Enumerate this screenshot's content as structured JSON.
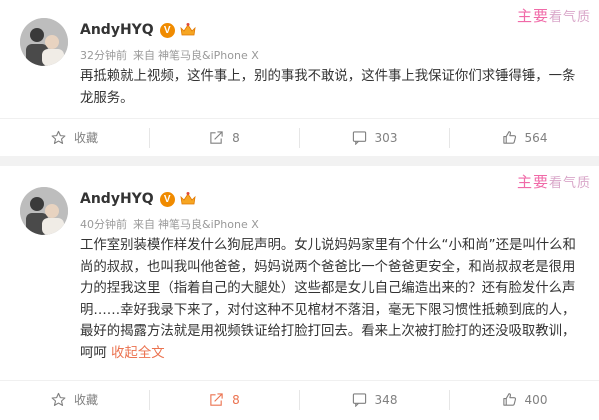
{
  "watermark": {
    "part1": "主要",
    "part2": "看气质"
  },
  "posts": [
    {
      "username": "AndyHYQ",
      "verified_badge": "V",
      "time": "32分钟前",
      "source_prefix": "来自",
      "source": "神笔马良&iPhone X",
      "text": "再抵赖就上视频，这件事上，别的事我不敢说，这件事上我保证你们求锤得锤，一条龙服务。",
      "expand_label": "",
      "actions": {
        "favorite": "收藏",
        "repost": "8",
        "comment": "303",
        "like": "564"
      }
    },
    {
      "username": "AndyHYQ",
      "verified_badge": "V",
      "time": "40分钟前",
      "source_prefix": "来自",
      "source": "神笔马良&iPhone X",
      "text": "工作室别装模作样发什么狗屁声明。女儿说妈妈家里有个什么“小和尚”还是叫什么和尚的叔叔，也叫我叫他爸爸，妈妈说两个爸爸比一个爸爸更安全，和尚叔叔老是很用力的捏我这里（指着自己的大腿处）这些都是女儿自己编造出来的？还有脸发什么声明……幸好我录下来了，对付这种不见棺材不落泪，毫无下限习惯性抵赖到底的人，最好的揭露方法就是用视频铁证给打脸打回去。看来上次被打脸打的还没吸取教训，呵呵",
      "expand_label": "收起全文",
      "actions": {
        "favorite": "收藏",
        "repost": "8",
        "comment": "348",
        "like": "400"
      }
    }
  ]
}
